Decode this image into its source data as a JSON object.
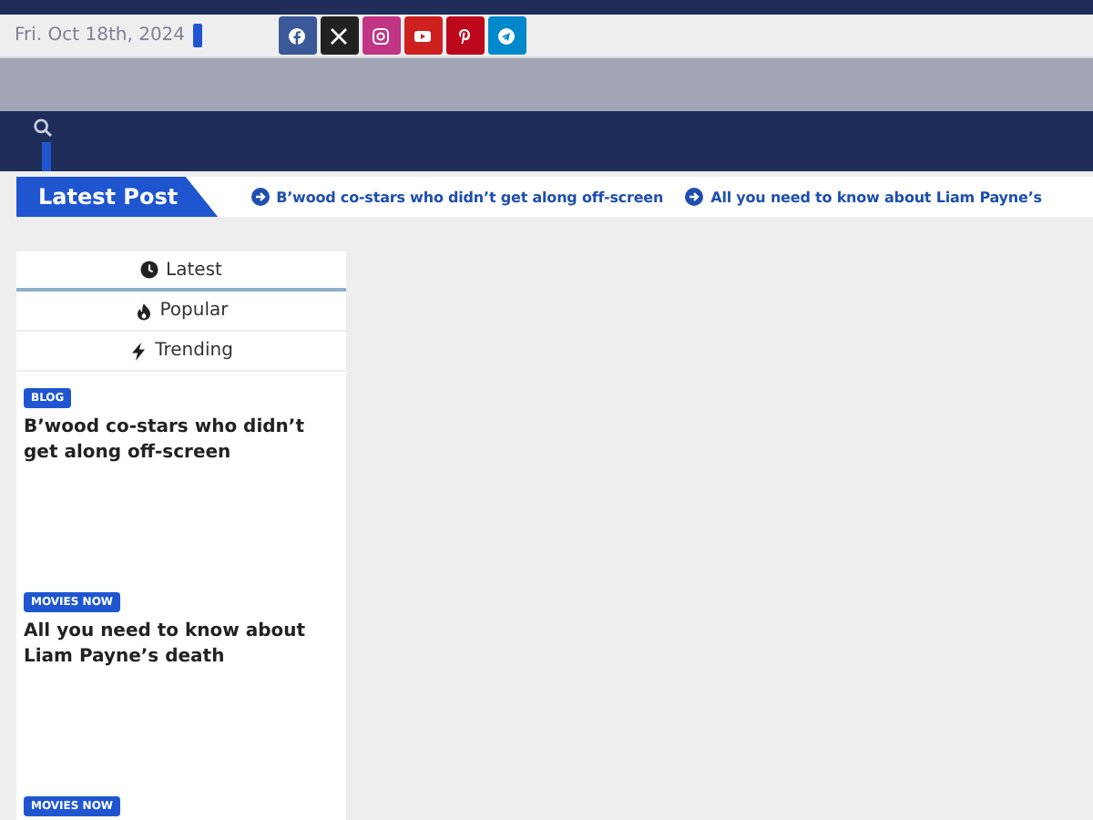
{
  "top_bar": {
    "date": "Fri. Oct 18th, 2024"
  },
  "social": [
    {
      "kind": "facebook",
      "color": "#3b5998"
    },
    {
      "kind": "x",
      "color": "#222222"
    },
    {
      "kind": "instagram",
      "color": "#c13584"
    },
    {
      "kind": "youtube",
      "color": "#cd201f"
    },
    {
      "kind": "pinterest",
      "color": "#bd081c"
    },
    {
      "kind": "telegram",
      "color": "#0088cc"
    }
  ],
  "ticker": {
    "label": "Latest Post",
    "items": [
      "B’wood co-stars who didn’t get along off-screen",
      "All you need to know about Liam Payne’s"
    ]
  },
  "tabs": [
    {
      "label": "Latest",
      "kind": "clock",
      "selected": true
    },
    {
      "label": "Popular",
      "kind": "fire",
      "selected": false
    },
    {
      "label": "Trending",
      "kind": "bolt",
      "selected": false
    }
  ],
  "posts": [
    {
      "category": "BLOG",
      "title": "B’wood co-stars who didn’t get along off-screen"
    },
    {
      "category": "MOVIES NOW",
      "title": "All you need to know about Liam Payne’s death"
    },
    {
      "category": "MOVIES NOW"
    }
  ]
}
